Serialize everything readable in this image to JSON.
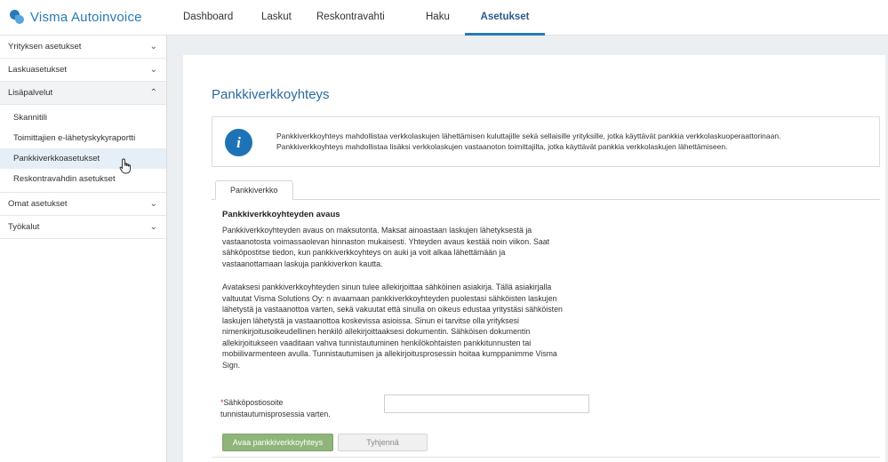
{
  "app": {
    "logo_text": "Visma Autoinvoice"
  },
  "nav": {
    "items": [
      {
        "label": "Dashboard"
      },
      {
        "label": "Laskut"
      },
      {
        "label": "Reskontravahti"
      },
      {
        "label": "Haku"
      },
      {
        "label": "Asetukset"
      }
    ],
    "active": "Asetukset"
  },
  "sidebar": {
    "groups": [
      {
        "label": "Yrityksen asetukset",
        "chevron": "chevron-down-icon"
      },
      {
        "label": "Laskuasetukset",
        "chevron": "chevron-down-icon"
      },
      {
        "label": "Lisäpalvelut",
        "chevron": "chevron-up-icon",
        "items": [
          {
            "label": "Skannitili"
          },
          {
            "label": "Toimittajien e-lähetyskykyraportti"
          },
          {
            "label": "Pankkiverkkoasetukset"
          },
          {
            "label": "Reskontravahdin asetukset"
          }
        ]
      },
      {
        "label": "Omat asetukset",
        "chevron": "chevron-down-icon"
      },
      {
        "label": "Työkalut",
        "chevron": "chevron-down-icon"
      }
    ],
    "selected": "Pankkiverkkoasetukset"
  },
  "main": {
    "title": "Pankkiverkkoyhteys",
    "info": {
      "icon": "info-icon",
      "lines": [
        "Pankkiverkkoyhteys mahdollistaa verkkolaskujen lähettämisen kuluttajille sekä sellaisille yrityksille, jotka käyttävät pankkia verkkolaskuoperaattorinaan.",
        "Pankkiverkkoyhteys mahdollistaa lisäksi verkkolaskujen vastaanoton toimittajilta, jotka käyttävät pankkia verkkolaskujen lähettämiseen."
      ]
    },
    "tab_label": "Pankkiverkko",
    "section_title": "Pankkiverkkoyhteyden avaus",
    "paragraph1": [
      "Pankkiverkkoyhteyden avaus on maksutonta. Maksat ainoastaan laskujen lähetyksestä ja",
      "vastaanotosta voimassaolevan hinnaston mukaisesti. Yhteyden avaus kestää noin viikon. Saat",
      "sähköpostitse tiedon, kun pankkiverkkoyhteys on auki ja voit alkaa lähettämään ja",
      "vastaanottamaan laskuja pankkiverkon kautta."
    ],
    "paragraph2": [
      "Avataksesi pankkiverkkoyhteyden sinun tulee allekirjoittaa sähköinen asiakirja. Tällä asiakirjalla",
      "valtuutat Visma Solutions Oy: n avaamaan pankkiverkkoyhteyden puolestasi sähköisten laskujen",
      "lähetystä ja vastaanottoa varten, sekä vakuutat että sinulla on oikeus edustaa yritystäsi sähköisten",
      "laskujen lähetystä ja vastaanottoa koskevissa asioissa. Sinun ei tarvitse olla yrityksesi",
      "nimenkirjoitusoikeudellinen henkilö allekirjoittaaksesi dokumentin. Sähköisen dokumentin",
      "allekirjoitukseen vaaditaan vahva tunnistautuminen henkilökohtaisten pankkitunnusten tai",
      "mobiilivarmenteen avulla. Tunnistautumisen ja allekirjoitusprosessin hoitaa kumppanimme Visma",
      "Sign."
    ],
    "email": {
      "required_mark": "*",
      "label_line1": "Sähköpostiosoite",
      "label_line2": "tunnistautumisprosessia varten.",
      "value": "",
      "placeholder": ""
    },
    "buttons": {
      "primary": "Avaa pankkiverkkoyhteys",
      "secondary": "Tyhjennä"
    }
  },
  "colors": {
    "brand": "#2a7ab8",
    "primary_button": "#8fb57a",
    "info_icon": "#1e73b6",
    "title": "#2a6a9e"
  }
}
